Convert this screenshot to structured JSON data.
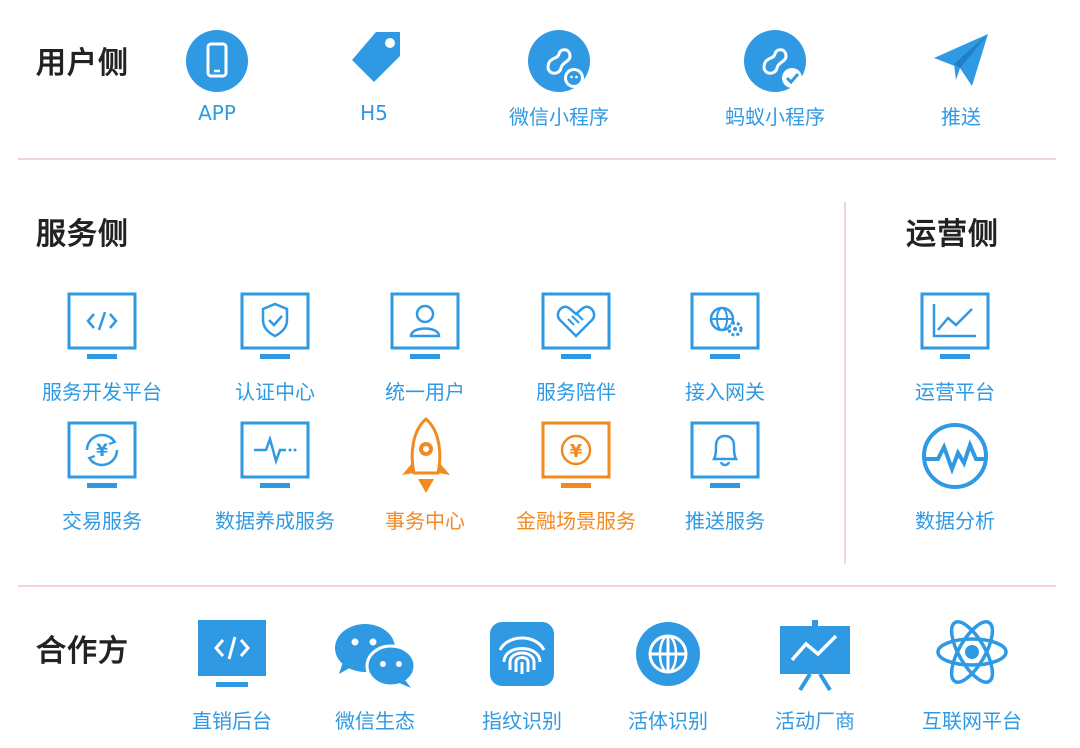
{
  "colors": {
    "blue": "#2f9ae3",
    "orange": "#f28a22",
    "divider": "#f7d4d4",
    "title": "#222222"
  },
  "user_side": {
    "title": "用户侧",
    "items": [
      {
        "label": "APP",
        "icon": "phone-icon"
      },
      {
        "label": "H5",
        "icon": "tag-icon"
      },
      {
        "label": "微信小程序",
        "icon": "wechat-miniprogram-icon"
      },
      {
        "label": "蚂蚁小程序",
        "icon": "alipay-miniprogram-icon"
      },
      {
        "label": "推送",
        "icon": "paper-plane-icon"
      }
    ]
  },
  "service_side": {
    "title": "服务侧",
    "items": [
      {
        "label": "服务开发平台",
        "icon": "code-monitor-icon"
      },
      {
        "label": "认证中心",
        "icon": "shield-check-monitor-icon"
      },
      {
        "label": "统一用户",
        "icon": "user-monitor-icon"
      },
      {
        "label": "服务陪伴",
        "icon": "handshake-heart-monitor-icon"
      },
      {
        "label": "接入网关",
        "icon": "globe-gear-monitor-icon"
      },
      {
        "label": "交易服务",
        "icon": "yen-cycle-monitor-icon"
      },
      {
        "label": "数据养成服务",
        "icon": "pulse-monitor-icon"
      },
      {
        "label": "事务中心",
        "icon": "rocket-icon"
      },
      {
        "label": "金融场景服务",
        "icon": "yen-monitor-icon"
      },
      {
        "label": "推送服务",
        "icon": "bell-monitor-icon"
      }
    ]
  },
  "ops_side": {
    "title": "运营侧",
    "items": [
      {
        "label": "运营平台",
        "icon": "line-chart-monitor-icon"
      },
      {
        "label": "数据分析",
        "icon": "analytics-circle-icon"
      }
    ]
  },
  "partners": {
    "title": "合作方",
    "items": [
      {
        "label": "直销后台",
        "icon": "code-screen-icon"
      },
      {
        "label": "微信生态",
        "icon": "wechat-icon"
      },
      {
        "label": "指纹识别",
        "icon": "fingerprint-icon"
      },
      {
        "label": "活体识别",
        "icon": "face-globe-icon"
      },
      {
        "label": "活动厂商",
        "icon": "presentation-board-icon"
      },
      {
        "label": "互联网平台",
        "icon": "atom-icon"
      }
    ]
  }
}
